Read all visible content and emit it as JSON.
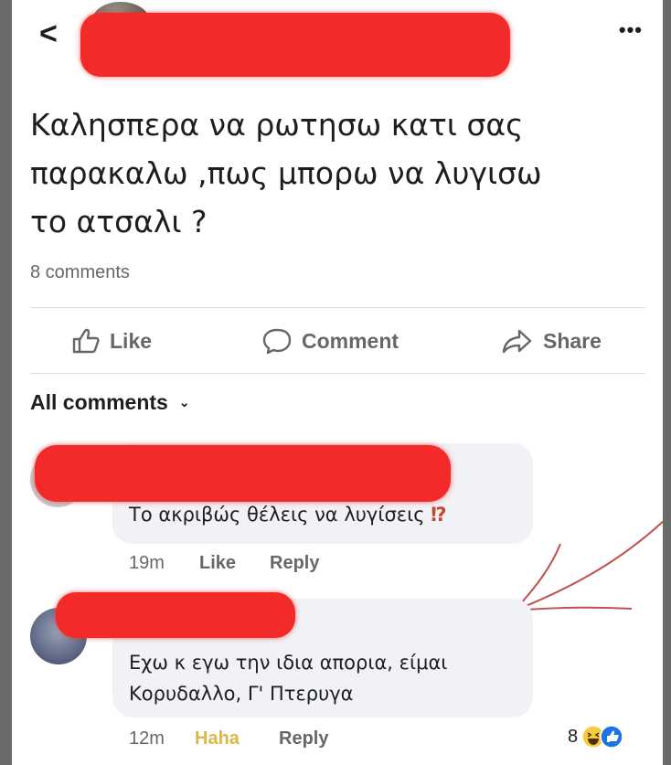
{
  "header": {
    "back_glyph": "<",
    "more_glyph": "•••"
  },
  "post": {
    "text": "Καλησπερα να ρωτησω κατι σας\nπαρακαλω ,πως μπορω να λυγισω\nτο ατσαλι ?",
    "comments_count": "8 comments"
  },
  "actions": {
    "like": "Like",
    "comment": "Comment",
    "share": "Share"
  },
  "comments_section": {
    "filter_label": "All comments"
  },
  "comments": [
    {
      "text": "Το ακριβώς θέλεις να λυγίσεις",
      "emphasis": "⁉",
      "time": "19m",
      "like": "Like",
      "reply": "Reply"
    },
    {
      "text": "Εχω κ εγω την ιδια απορια, είμαι\nΚορυδαλλο, Γ' Πτερυγα",
      "time": "12m",
      "reaction_label": "Haha",
      "reply": "Reply",
      "reaction_count": "8"
    }
  ],
  "colors": {
    "redaction": "#f22a2a",
    "haha_reaction": "#d9b84a",
    "text_primary": "#1c1e21",
    "text_secondary": "#65676b"
  }
}
